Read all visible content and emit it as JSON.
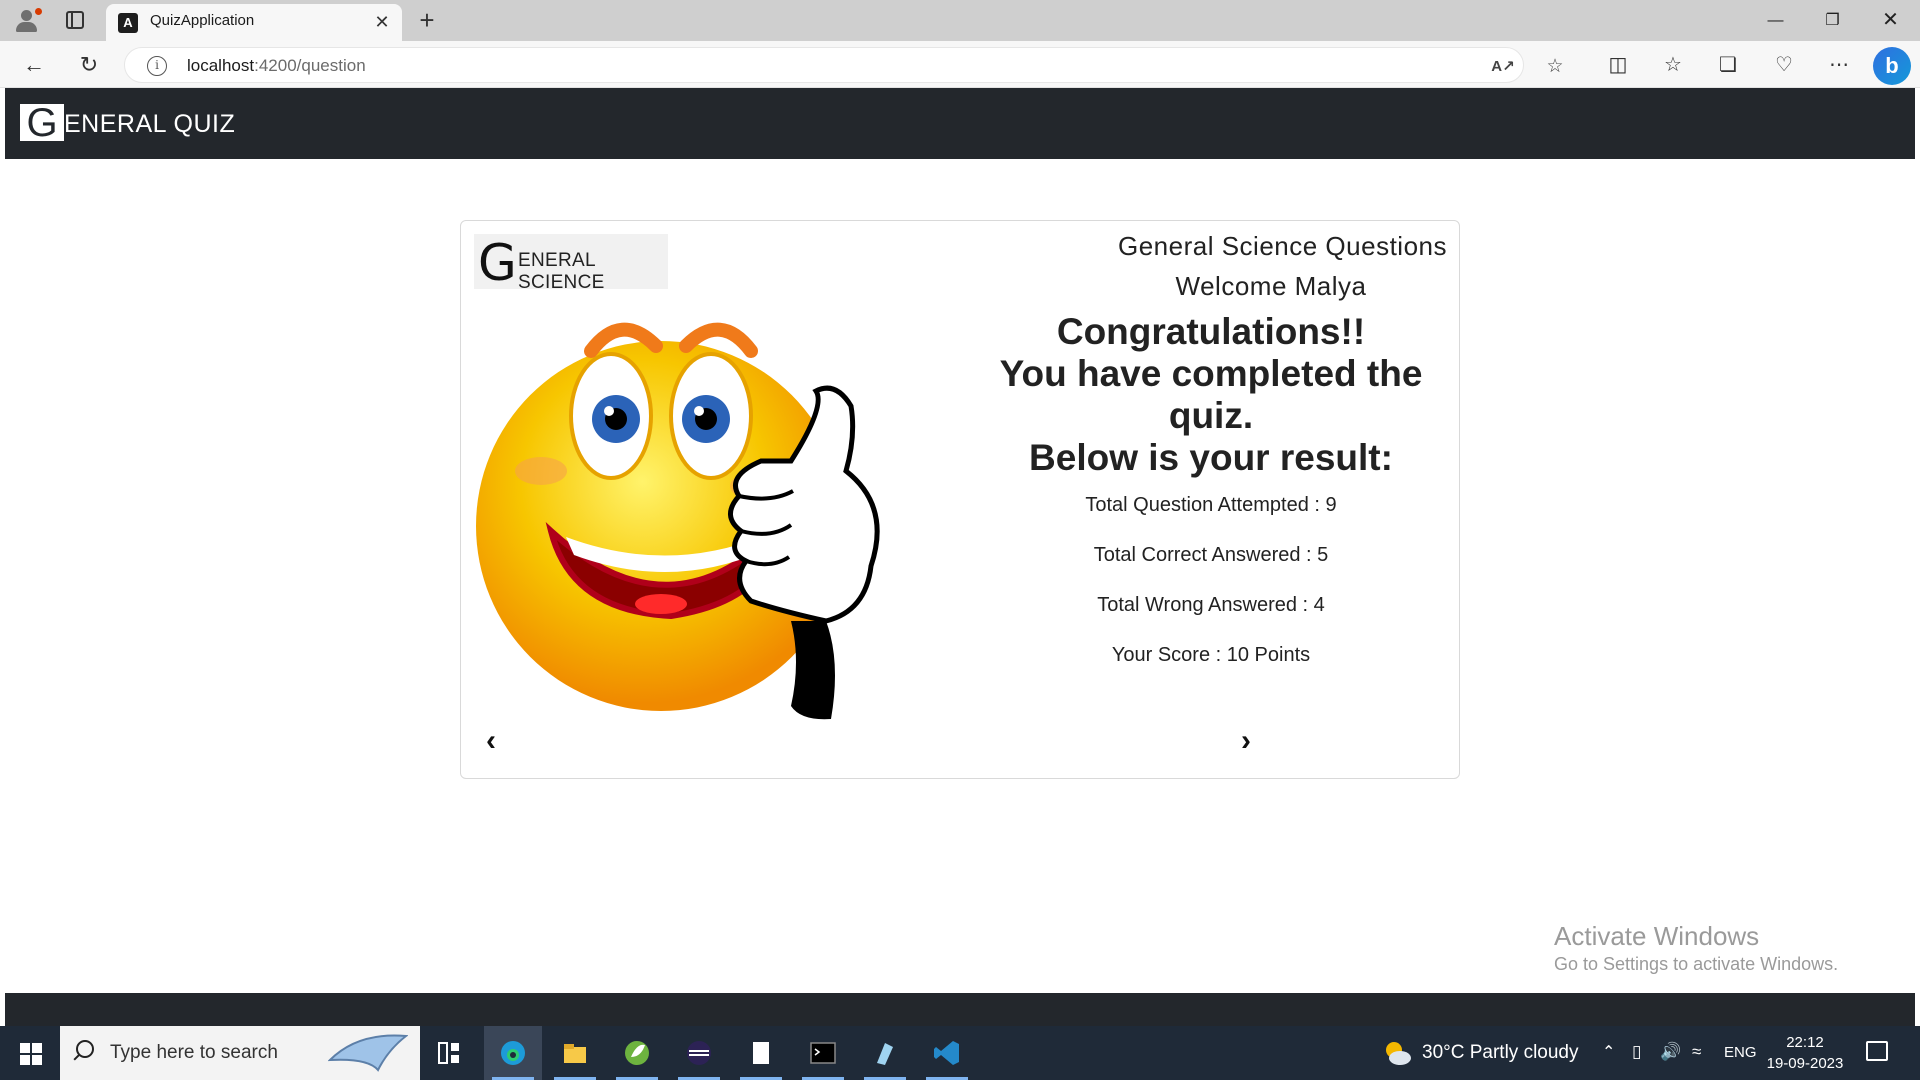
{
  "browser": {
    "tab_title": "QuizApplication",
    "url_host": "localhost",
    "url_rest": ":4200/question",
    "new_tab": "+",
    "tab_close": "✕"
  },
  "app": {
    "brand_initial": "G",
    "brand_rest": "ENERAL QUIZ"
  },
  "card": {
    "badge_initial": "G",
    "badge_rest": "ENERAL SCIENCE",
    "title": "General Science Questions",
    "welcome": "Welcome Malya",
    "congrats": "Congratulations!!",
    "completed": "You have completed the quiz.",
    "below": "Below is your result:",
    "total_attempted": "Total Question Attempted : 9",
    "total_correct": "Total Correct Answered : 5",
    "total_wrong": "Total Wrong Answered : 4",
    "score": "Your Score : 10 Points",
    "prev": "‹",
    "next": "›"
  },
  "watermark": {
    "title": "Activate Windows",
    "subtitle": "Go to Settings to activate Windows."
  },
  "taskbar": {
    "search_placeholder": "Type here to search",
    "weather": "30°C  Partly cloudy",
    "lang": "ENG",
    "time": "22:12",
    "date": "19-09-2023"
  },
  "colors": {
    "header_bg": "#23272c",
    "taskbar_bg": "#1f2a38",
    "smiley_yellow": "#f7c600"
  },
  "icons": [
    "profile-icon",
    "tabs-icon",
    "back-icon",
    "refresh-icon",
    "info-icon",
    "read-aloud-icon",
    "favorite-star-icon",
    "split-screen-icon",
    "favorites-icon",
    "collections-icon",
    "performance-icon",
    "more-icon",
    "bing-icon",
    "windows-start-icon",
    "search-icon",
    "edge-icon",
    "file-explorer-icon",
    "spring-icon",
    "eclipse-icon",
    "notepad-icon",
    "terminal-icon",
    "app-icon",
    "vscode-icon",
    "weather-icon",
    "chevron-up-icon",
    "battery-icon",
    "volume-icon",
    "wifi-icon",
    "notification-icon"
  ]
}
